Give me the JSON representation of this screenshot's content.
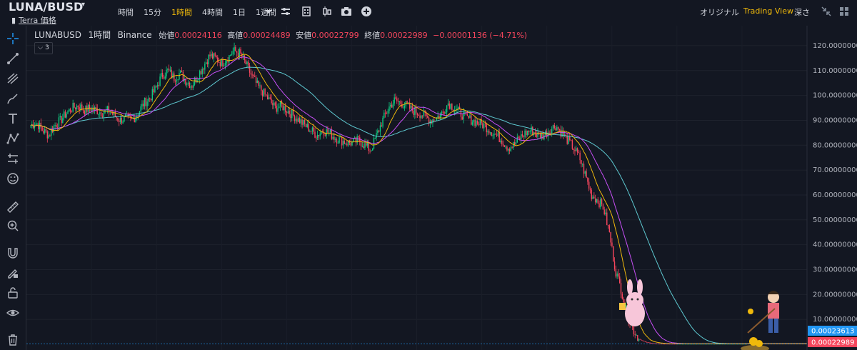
{
  "header": {
    "pair": "LUNA/BUSD",
    "price_label": "Terra 価格",
    "timeframes": [
      {
        "label": "時間",
        "active": false
      },
      {
        "label": "15分",
        "active": false
      },
      {
        "label": "1時間",
        "active": true
      },
      {
        "label": "4時間",
        "active": false
      },
      {
        "label": "1日",
        "active": false
      },
      {
        "label": "1週間",
        "active": false
      }
    ],
    "view_original": "オリジナル",
    "view_tradingview": "Trading View",
    "view_depth": "深さ"
  },
  "legend": {
    "symbol": "LUNABUSD",
    "interval": "1時間",
    "exchange": "Binance",
    "open_label": "始値",
    "open": "0.00024116",
    "high_label": "高値",
    "high": "0.00024489",
    "low_label": "安値",
    "low": "0.00022799",
    "close_label": "終値",
    "close": "0.00022989",
    "change": "−0.00001136 (−4.71%)",
    "indicator_count": "3"
  },
  "colors": {
    "background": "#131722",
    "up": "#0ecb81",
    "down": "#f6465d",
    "ma_fast": "#f0b90b",
    "ma_mid": "#c74ff5",
    "ma_slow": "#5ec8d0",
    "accent": "#f0b90b",
    "tag_blue": "#2196f3",
    "tag_red": "#f6465d"
  },
  "icons": [
    "crosshair-icon",
    "trendline-icon",
    "pitchfork-icon",
    "brush-icon",
    "text-icon",
    "pattern-icon",
    "measure-icon",
    "emoji-icon",
    "ruler-icon",
    "zoom-icon",
    "magnet-icon",
    "lock-pen-icon",
    "lock-icon",
    "eye-icon",
    "trash-icon"
  ],
  "chart_data": {
    "type": "candlestick",
    "ylim": [
      0,
      124
    ],
    "yticks": [
      {
        "value": 120,
        "label": "120.00000000"
      },
      {
        "value": 110,
        "label": "110.00000000"
      },
      {
        "value": 100,
        "label": "100.00000000"
      },
      {
        "value": 90,
        "label": "90.00000000"
      },
      {
        "value": 80,
        "label": "80.00000000"
      },
      {
        "value": 70,
        "label": "70.00000000"
      },
      {
        "value": 60,
        "label": "60.00000000"
      },
      {
        "value": 50,
        "label": "50.00000000"
      },
      {
        "value": 40,
        "label": "40.00000000"
      },
      {
        "value": 30,
        "label": "30.00000000"
      },
      {
        "value": 20,
        "label": "20.00000000"
      },
      {
        "value": 10,
        "label": "10.00000000"
      }
    ],
    "price_path": [
      88,
      89,
      86,
      84,
      88,
      90,
      93,
      95,
      96,
      94,
      95,
      94,
      93,
      94,
      92,
      90,
      91,
      90,
      93,
      97,
      99,
      103,
      108,
      110,
      107,
      109,
      106,
      104,
      108,
      112,
      116,
      115,
      113,
      115,
      118,
      117,
      113,
      108,
      104,
      101,
      98,
      95,
      96,
      94,
      92,
      90,
      88,
      86,
      84,
      86,
      85,
      83,
      82,
      81,
      81,
      82,
      80,
      78,
      84,
      90,
      95,
      98,
      97,
      96,
      94,
      93,
      92,
      90,
      91,
      93,
      97,
      95,
      93,
      91,
      90,
      89,
      88,
      86,
      84,
      82,
      79,
      80,
      83,
      85,
      86,
      84,
      84,
      86,
      88,
      85,
      82,
      79,
      75,
      68,
      60,
      58,
      55,
      45,
      30,
      22,
      12,
      6,
      2,
      1,
      0.5,
      0.3,
      0.25,
      0.24,
      0.23,
      0.23,
      0.23,
      0.23,
      0.23,
      0.23,
      0.23,
      0.23,
      0.23,
      0.23,
      0.23,
      0.23,
      0.23
    ],
    "ma_fast_period": 3,
    "ma_mid_period": 6,
    "ma_slow_period": 14,
    "last_price_tags": [
      {
        "label": "0.00023613",
        "color": "#2196f3"
      },
      {
        "label": "0.00022989",
        "color": "#f6465d"
      }
    ]
  }
}
